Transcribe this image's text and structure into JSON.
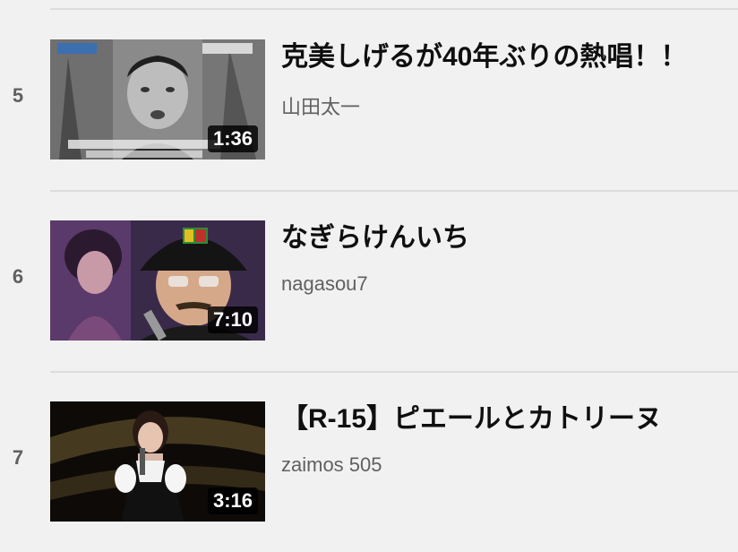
{
  "playlist": {
    "items": [
      {
        "index": "5",
        "title": "克美しげるが40年ぶりの熱唱！！",
        "channel": "山田太一",
        "duration": "1:36"
      },
      {
        "index": "6",
        "title": "なぎらけんいち",
        "channel": "nagasou7",
        "duration": "7:10"
      },
      {
        "index": "7",
        "title": "【R-15】ピエールとカトリーヌ",
        "channel": "zaimos 505",
        "duration": "3:16"
      }
    ]
  }
}
